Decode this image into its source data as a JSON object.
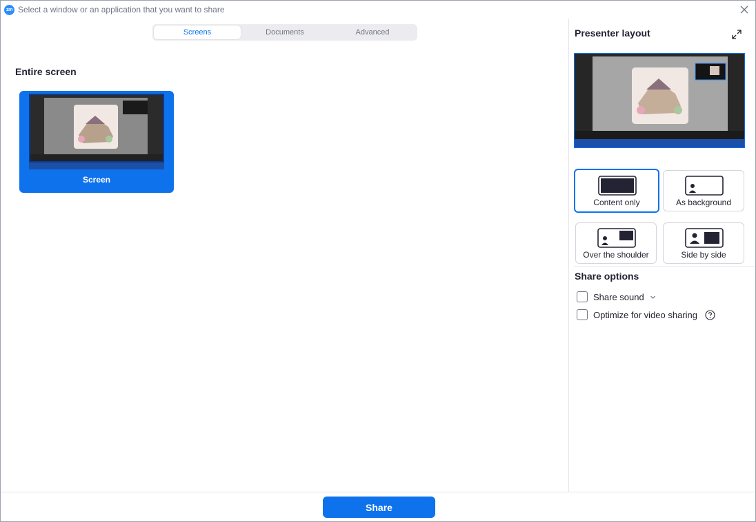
{
  "titlebar": {
    "app_logo": "zm",
    "title": "Select a window or an application that you want to share",
    "close_icon": "close-icon"
  },
  "tabs": [
    {
      "label": "Screens",
      "active": true
    },
    {
      "label": "Documents",
      "active": false
    },
    {
      "label": "Advanced",
      "active": false
    }
  ],
  "left_pane": {
    "section_title": "Entire screen",
    "screens": [
      {
        "label": "Screen",
        "selected": true
      }
    ]
  },
  "right_pane": {
    "presenter_title": "Presenter layout",
    "expand_icon": "expand-icon",
    "layouts": [
      {
        "label": "Content only",
        "selected": true,
        "icon": "content-only-icon"
      },
      {
        "label": "As background",
        "selected": false,
        "icon": "as-background-icon"
      },
      {
        "label": "Over the shoulder",
        "selected": false,
        "icon": "over-shoulder-icon"
      },
      {
        "label": "Side by side",
        "selected": false,
        "icon": "side-by-side-icon"
      }
    ],
    "share_options_title": "Share options",
    "options": [
      {
        "label": "Share sound",
        "checked": false,
        "has_dropdown": true
      },
      {
        "label": "Optimize for video sharing",
        "checked": false,
        "has_help": true
      }
    ]
  },
  "footer": {
    "share_label": "Share"
  },
  "colors": {
    "accent": "#0e72ed",
    "text": "#232333",
    "muted": "#747487"
  }
}
